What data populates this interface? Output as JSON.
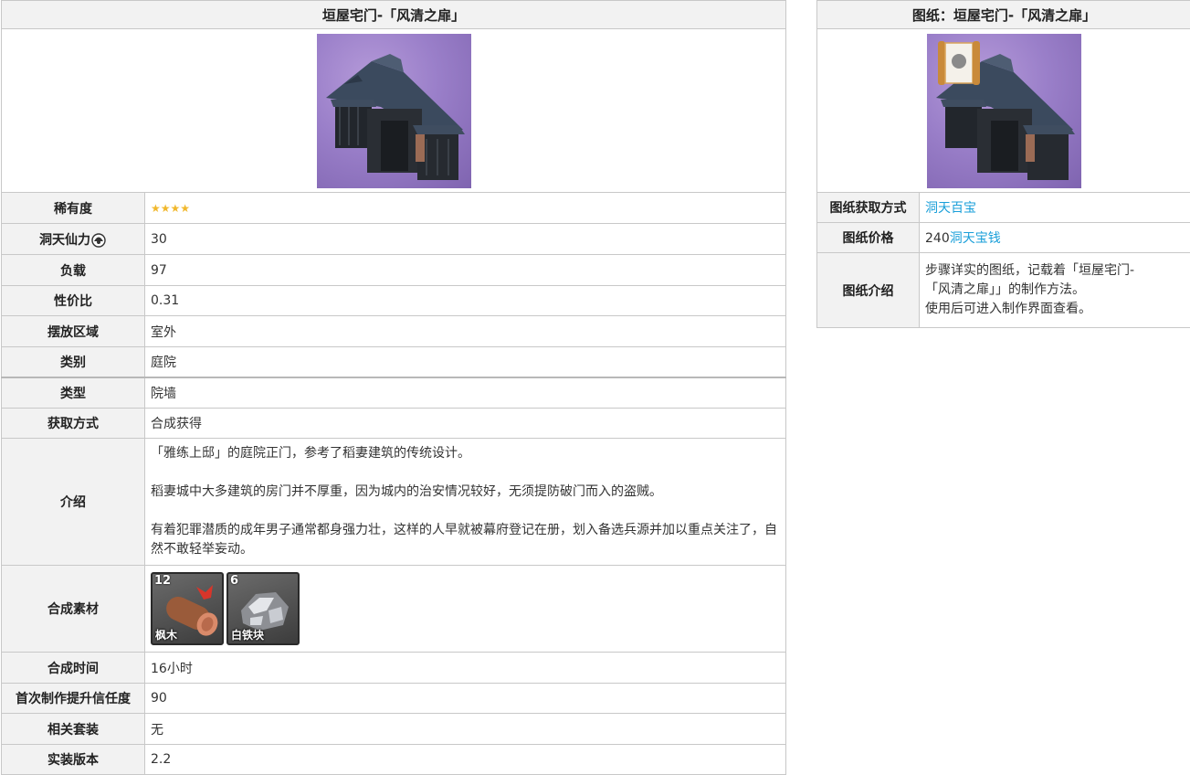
{
  "main": {
    "title": "垣屋宅门-「风清之扉」",
    "rows": {
      "rarity": {
        "label": "稀有度",
        "stars": "★★★★",
        "star_count": 4
      },
      "adeptal": {
        "label": "洞天仙力",
        "value": "30"
      },
      "load": {
        "label": "负载",
        "value": "97"
      },
      "ratio": {
        "label": "性价比",
        "value": "0.31"
      },
      "placement": {
        "label": "摆放区域",
        "value": "室外"
      },
      "category": {
        "label": "类别",
        "value": "庭院"
      },
      "type": {
        "label": "类型",
        "value": "院墙"
      },
      "obtain": {
        "label": "获取方式",
        "value": "合成获得"
      },
      "intro": {
        "label": "介绍",
        "p1": "「雅练上邸」的庭院正门，参考了稻妻建筑的传统设计。",
        "p2": "稻妻城中大多建筑的房门并不厚重，因为城内的治安情况较好，无须提防破门而入的盗贼。",
        "p3": "有着犯罪潜质的成年男子通常都身强力壮，这样的人早就被幕府登记在册，划入备选兵源并加以重点关注了，自然不敢轻举妄动。"
      },
      "materials": {
        "label": "合成素材",
        "items": [
          {
            "count": "12",
            "name": "枫木",
            "icon": "maple-wood-icon"
          },
          {
            "count": "6",
            "name": "白铁块",
            "icon": "white-iron-chunk-icon"
          }
        ]
      },
      "craft_time": {
        "label": "合成时间",
        "value": "16小时"
      },
      "trust": {
        "label": "首次制作提升信任度",
        "value": "90"
      },
      "set": {
        "label": "相关套装",
        "value": "无"
      },
      "version": {
        "label": "实装版本",
        "value": "2.2"
      }
    }
  },
  "blueprint": {
    "title": "图纸：垣屋宅门-「风清之扉」",
    "rows": {
      "source": {
        "label": "图纸获取方式",
        "link": "洞天百宝"
      },
      "price": {
        "label": "图纸价格",
        "amount": "240",
        "currency": "洞天宝钱"
      },
      "intro": {
        "label": "图纸介绍",
        "line1": "步骤详实的图纸，记载着「垣屋宅门-",
        "line2": "「风清之扉」」的制作方法。",
        "line3": "使用后可进入制作界面查看。"
      }
    }
  },
  "colors": {
    "header_bg": "#f2f2f2",
    "link": "#1a9fd9",
    "star": "#f1b82d",
    "thumb_bg": "#9a7fc9"
  }
}
